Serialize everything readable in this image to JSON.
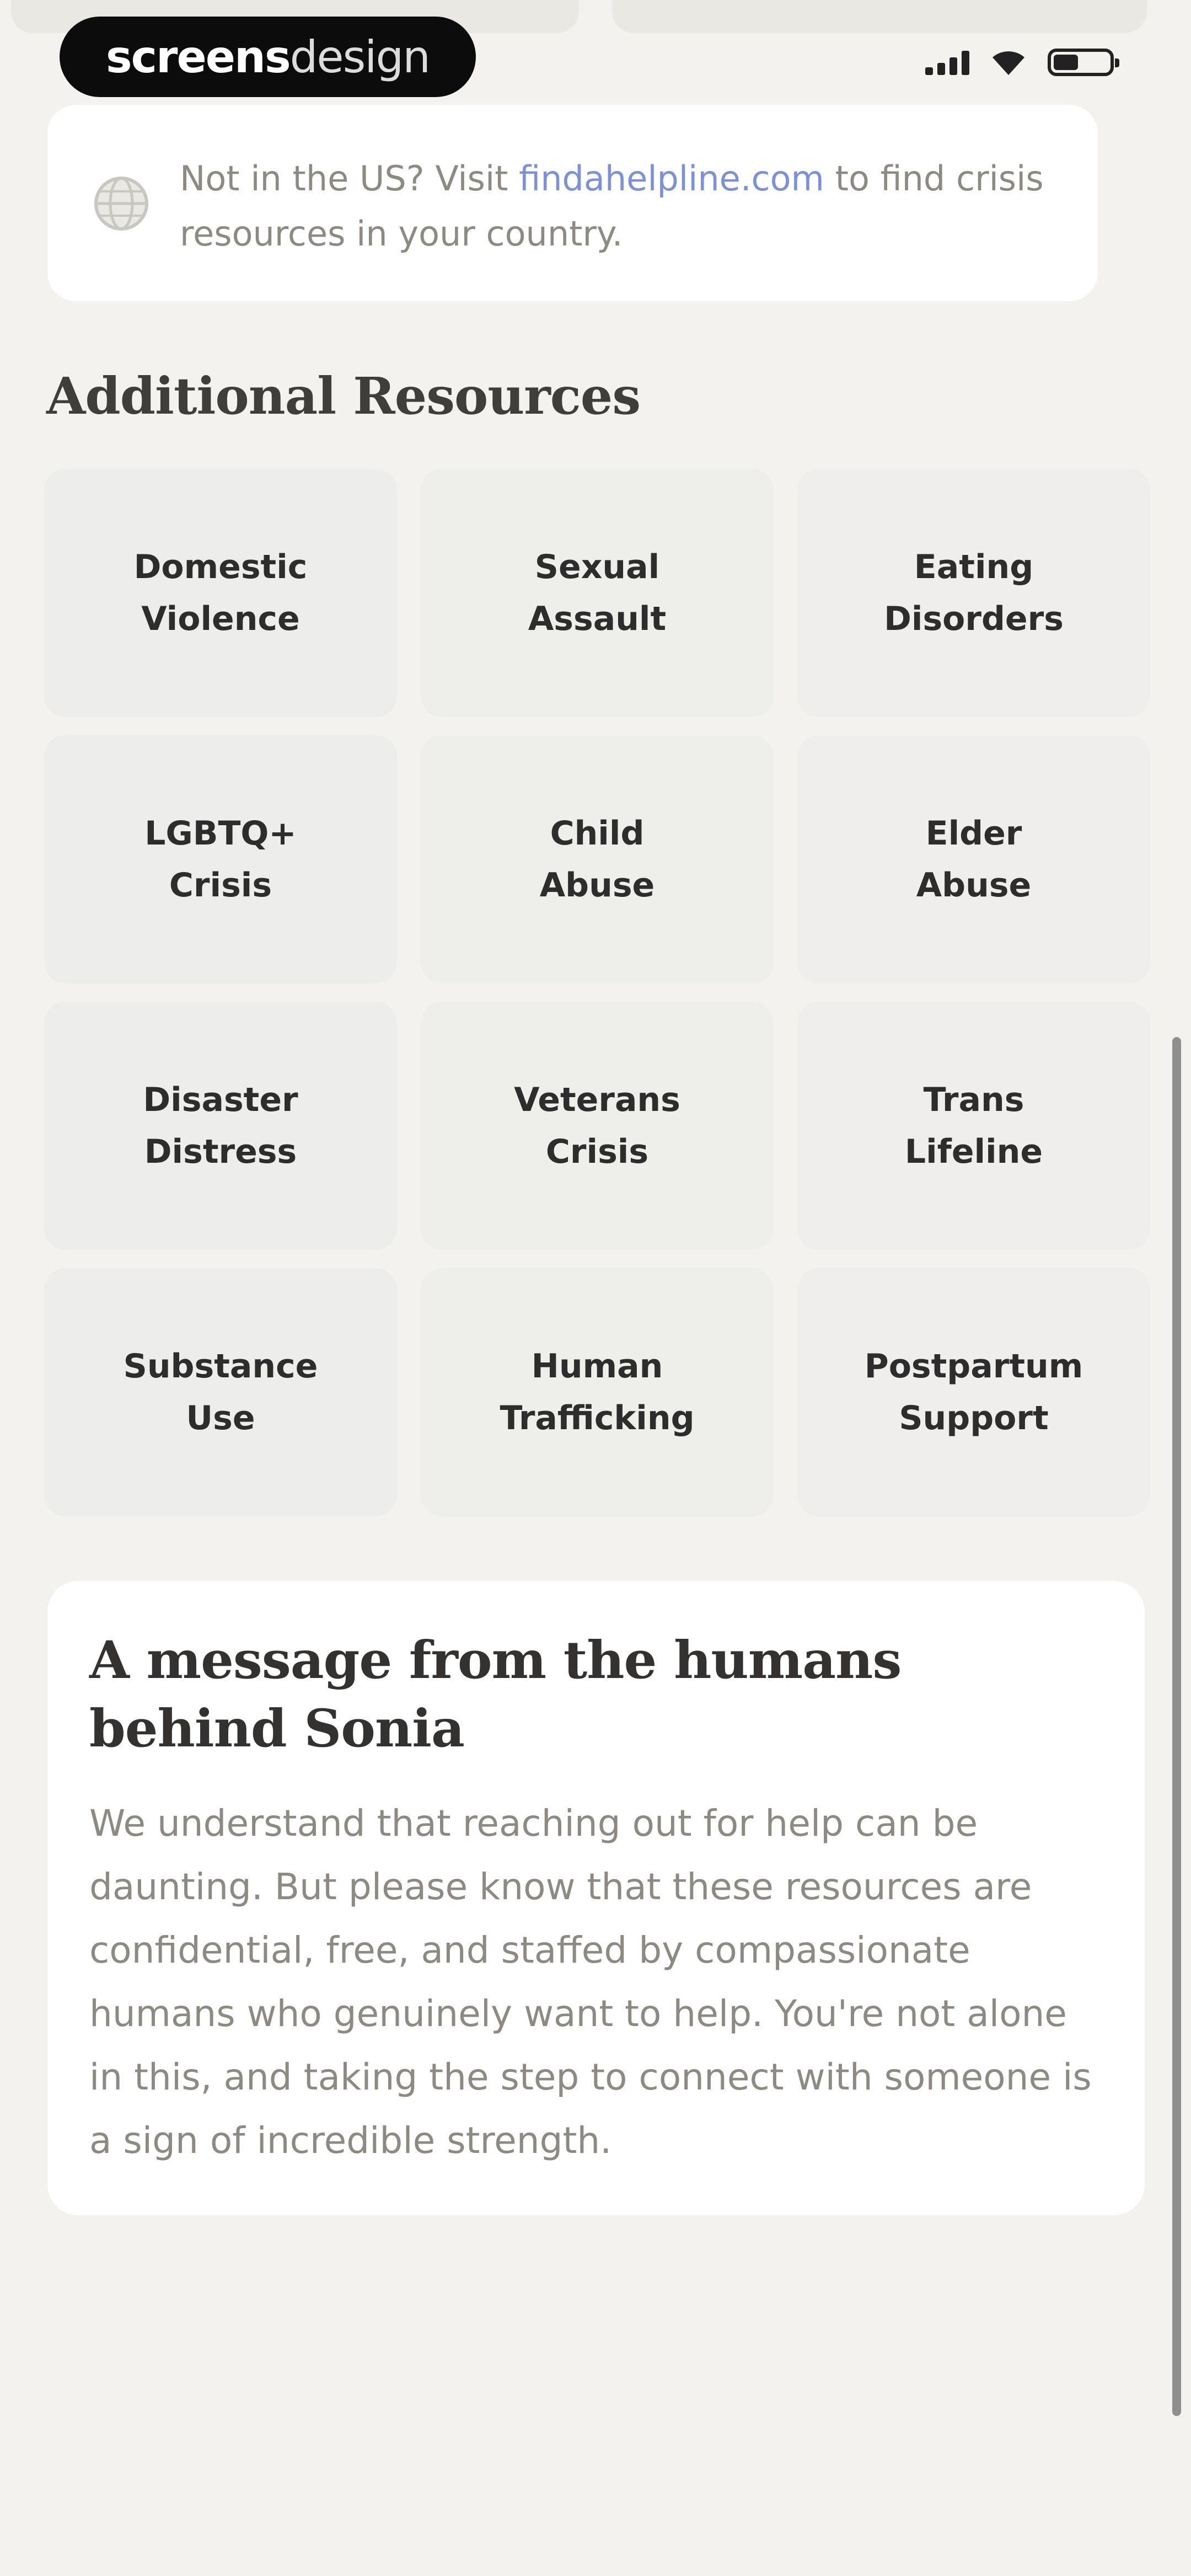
{
  "watermark": {
    "bold": "screens",
    "light": "design"
  },
  "info": {
    "prefix": "Not in the US? Visit ",
    "link": "findahelpline.com",
    "suffix": " to find crisis resources in your country."
  },
  "section_title": "Additional Resources",
  "resources": [
    {
      "line1": "Domestic",
      "line2": "Violence"
    },
    {
      "line1": "Sexual",
      "line2": "Assault"
    },
    {
      "line1": "Eating",
      "line2": "Disorders"
    },
    {
      "line1": "LGBTQ+",
      "line2": "Crisis"
    },
    {
      "line1": "Child",
      "line2": "Abuse"
    },
    {
      "line1": "Elder",
      "line2": "Abuse"
    },
    {
      "line1": "Disaster",
      "line2": "Distress"
    },
    {
      "line1": "Veterans",
      "line2": "Crisis"
    },
    {
      "line1": "Trans",
      "line2": "Lifeline"
    },
    {
      "line1": "Substance",
      "line2": "Use"
    },
    {
      "line1": "Human",
      "line2": "Trafficking"
    },
    {
      "line1": "Postpartum",
      "line2": "Support"
    }
  ],
  "message": {
    "title": "A message from the humans behind Sonia",
    "body": "We understand that reaching out for help can be daunting. But please know that these resources are confidential, free, and staffed by compassionate humans who genuinely want to help. You're not alone in this, and taking the step to connect with someone is a sign of incredible strength."
  },
  "icons": {
    "globe": "globe-icon",
    "signal": "cellular-signal-icon",
    "wifi": "wifi-icon",
    "battery": "battery-icon"
  },
  "colors": {
    "background": "#f3f2ee",
    "card": "#ffffff",
    "link": "#7d90d8",
    "muted_text": "#8d8a84"
  }
}
